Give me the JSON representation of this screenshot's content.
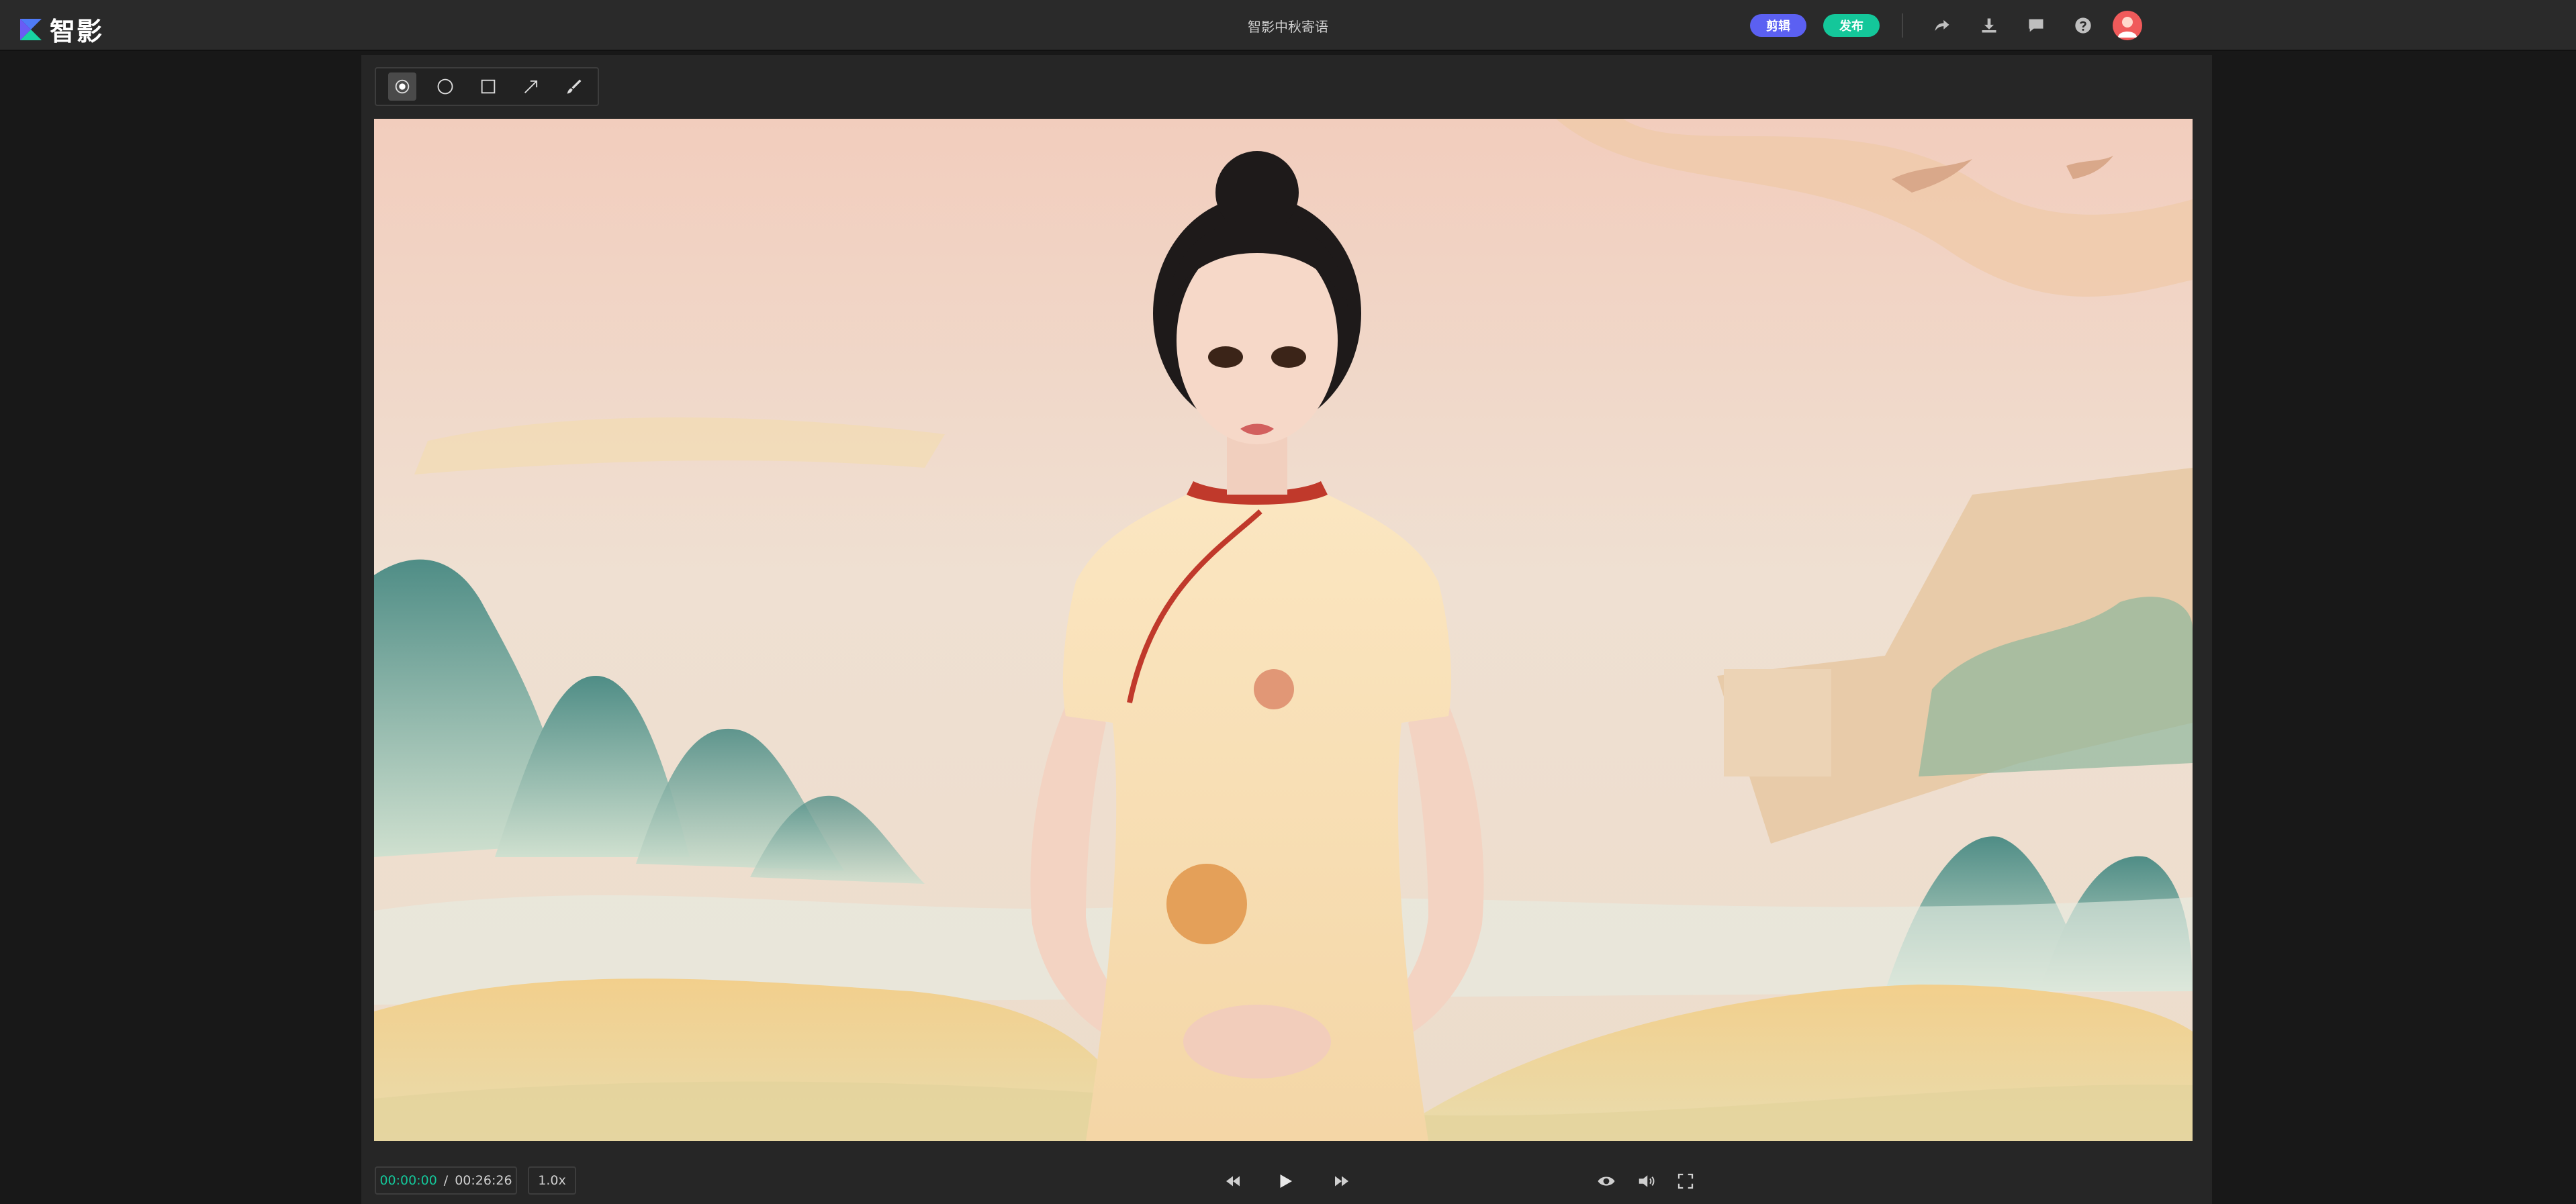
{
  "app": {
    "logo_text": "智影",
    "document_title": "智影中秋寄语"
  },
  "header": {
    "edit_label": "剪辑",
    "publish_label": "发布",
    "icons": [
      "share-icon",
      "download-icon",
      "comment-icon",
      "help-icon",
      "avatar"
    ]
  },
  "toolbar": {
    "tools": [
      "point-tool",
      "circle-tool",
      "rectangle-tool",
      "arrow-tool",
      "brush-tool"
    ],
    "active_tool": "point-tool"
  },
  "preview": {
    "subject": "digital-human-presenter",
    "background": "chinese-landscape-illustration"
  },
  "playback": {
    "current_time": "00:00:00",
    "separator": "/",
    "total_time": "00:26:26",
    "speed": "1.0x",
    "icons": [
      "rewind-icon",
      "play-icon",
      "fast-forward-icon",
      "preview-eye-icon",
      "volume-icon",
      "fullscreen-icon"
    ]
  },
  "colors": {
    "accent_edit": "#5b60f2",
    "accent_publish": "#14c79a",
    "time_current": "#14c79a"
  }
}
